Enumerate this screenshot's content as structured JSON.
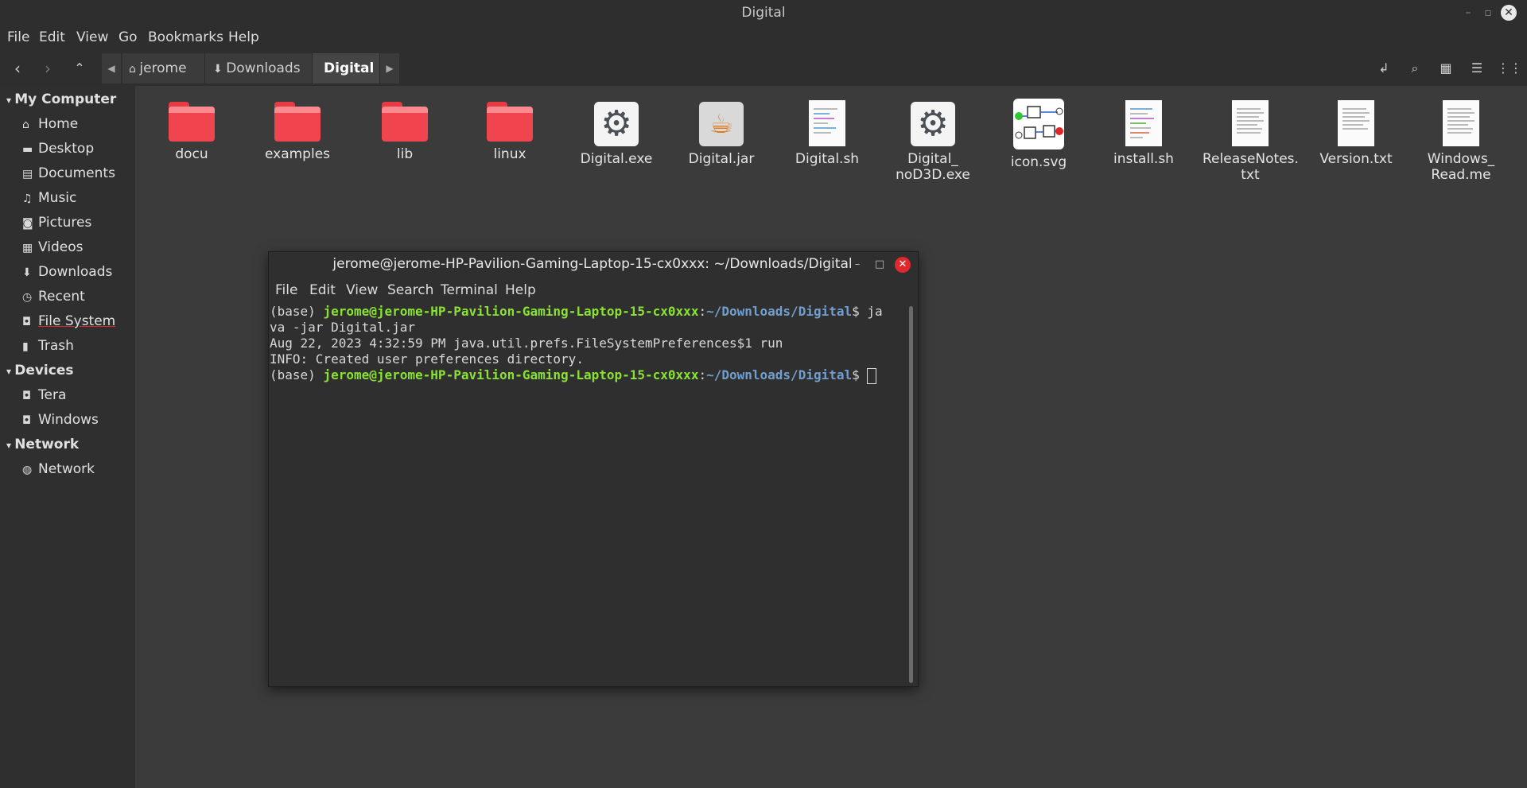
{
  "window": {
    "title": "Digital"
  },
  "menubar": [
    "File",
    "Edit",
    "View",
    "Go",
    "Bookmarks",
    "Help"
  ],
  "breadcrumbs": [
    "jerome",
    "Downloads",
    "Digital"
  ],
  "sidebar": {
    "sections": [
      {
        "title": "My Computer",
        "items": [
          {
            "label": "Home",
            "icon": "home-icon"
          },
          {
            "label": "Desktop",
            "icon": "desktop-icon"
          },
          {
            "label": "Documents",
            "icon": "documents-icon"
          },
          {
            "label": "Music",
            "icon": "music-icon"
          },
          {
            "label": "Pictures",
            "icon": "pictures-icon"
          },
          {
            "label": "Videos",
            "icon": "videos-icon"
          },
          {
            "label": "Downloads",
            "icon": "downloads-icon"
          },
          {
            "label": "Recent",
            "icon": "recent-icon"
          },
          {
            "label": "File System",
            "icon": "drive-icon"
          },
          {
            "label": "Trash",
            "icon": "trash-icon"
          }
        ]
      },
      {
        "title": "Devices",
        "items": [
          {
            "label": "Tera",
            "icon": "drive-icon"
          },
          {
            "label": "Windows",
            "icon": "drive-icon"
          }
        ]
      },
      {
        "title": "Network",
        "items": [
          {
            "label": "Network",
            "icon": "network-icon"
          }
        ]
      }
    ]
  },
  "files": [
    {
      "name": "docu",
      "type": "folder"
    },
    {
      "name": "examples",
      "type": "folder"
    },
    {
      "name": "lib",
      "type": "folder"
    },
    {
      "name": "linux",
      "type": "folder"
    },
    {
      "name": "Digital.exe",
      "type": "executable"
    },
    {
      "name": "Digital.jar",
      "type": "java"
    },
    {
      "name": "Digital.sh",
      "type": "script"
    },
    {
      "name": "Digital_\nnoD3D.exe",
      "type": "executable"
    },
    {
      "name": "icon.svg",
      "type": "svg"
    },
    {
      "name": "install.sh",
      "type": "script"
    },
    {
      "name": "ReleaseNotes.\ntxt",
      "type": "text"
    },
    {
      "name": "Version.txt",
      "type": "text"
    },
    {
      "name": "Windows_\nRead.me",
      "type": "text"
    }
  ],
  "terminal": {
    "title": "jerome@jerome-HP-Pavilion-Gaming-Laptop-15-cx0xxx: ~/Downloads/Digital",
    "menu": [
      "File",
      "Edit",
      "View",
      "Search",
      "Terminal",
      "Help"
    ],
    "prefix": "(base) ",
    "user_host": "jerome@jerome-HP-Pavilion-Gaming-Laptop-15-cx0xxx",
    "colon": ":",
    "path": "~/Downloads/Digital",
    "dollar": "$ ",
    "cmd_part1": "ja",
    "cmd_part2": "va -jar Digital.jar",
    "line3": "Aug 22, 2023 4:32:59 PM java.util.prefs.FileSystemPreferences$1 run",
    "line4": "INFO: Created user preferences directory."
  }
}
